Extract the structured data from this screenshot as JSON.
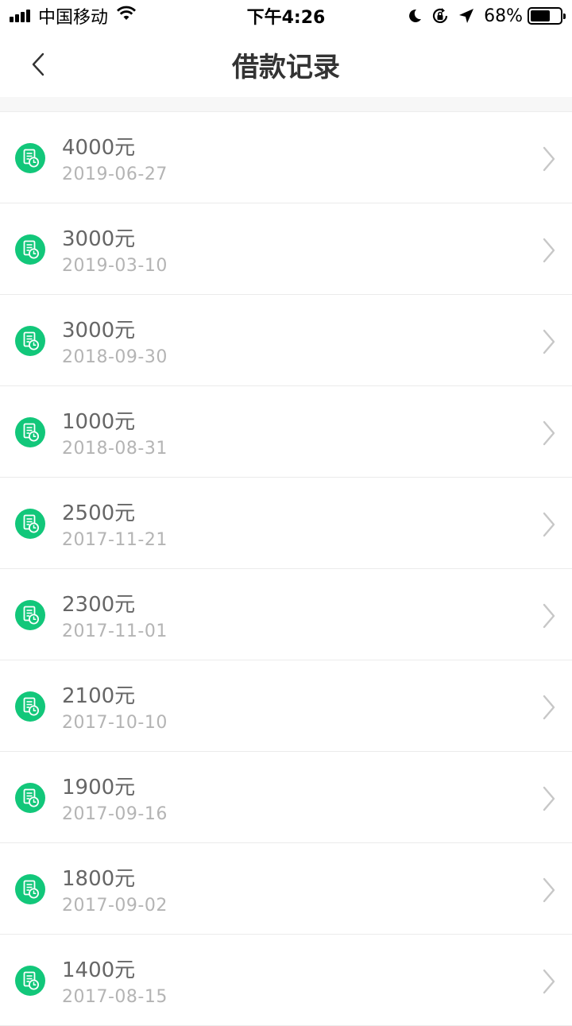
{
  "status_bar": {
    "carrier": "中国移动",
    "time": "下午4:26",
    "battery_percent": "68%",
    "battery_level": 0.68,
    "icons": [
      "signal-icon",
      "wifi-icon",
      "moon-icon",
      "rotation-lock-icon",
      "location-arrow-icon",
      "battery-icon"
    ]
  },
  "nav": {
    "title": "借款记录",
    "back_icon": "chevron-left-icon"
  },
  "theme": {
    "accent": "#12c77a",
    "amount_color": "#666666",
    "date_color": "#b4b4b4",
    "chevron_color": "#c7c7c7"
  },
  "records": [
    {
      "amount": "4000元",
      "date": "2019-06-27"
    },
    {
      "amount": "3000元",
      "date": "2019-03-10"
    },
    {
      "amount": "3000元",
      "date": "2018-09-30"
    },
    {
      "amount": "1000元",
      "date": "2018-08-31"
    },
    {
      "amount": "2500元",
      "date": "2017-11-21"
    },
    {
      "amount": "2300元",
      "date": "2017-11-01"
    },
    {
      "amount": "2100元",
      "date": "2017-10-10"
    },
    {
      "amount": "1900元",
      "date": "2017-09-16"
    },
    {
      "amount": "1800元",
      "date": "2017-09-02"
    },
    {
      "amount": "1400元",
      "date": "2017-08-15"
    }
  ]
}
